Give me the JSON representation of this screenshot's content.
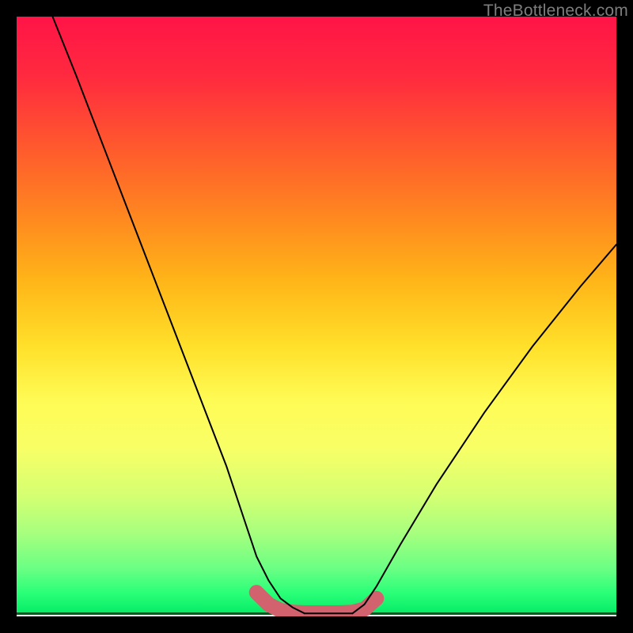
{
  "watermark": {
    "text": "TheBottleneck.com"
  },
  "colors": {
    "curve": "#000000",
    "highlight": "#d2636e",
    "background_black": "#000000"
  },
  "chart_data": {
    "type": "line",
    "title": "",
    "xlabel": "",
    "ylabel": "",
    "xlim": [
      0,
      100
    ],
    "ylim": [
      0,
      100
    ],
    "grid": false,
    "series": [
      {
        "name": "left-curve",
        "x": [
          6,
          10,
          15,
          20,
          25,
          30,
          35,
          38,
          40,
          42,
          44,
          46,
          48
        ],
        "y": [
          100,
          90,
          77,
          64,
          51,
          38,
          25,
          16,
          10,
          6,
          3,
          1.5,
          0.5
        ]
      },
      {
        "name": "bottom-flat",
        "x": [
          48,
          50,
          52,
          54,
          56
        ],
        "y": [
          0.5,
          0.5,
          0.5,
          0.5,
          0.5
        ]
      },
      {
        "name": "right-curve",
        "x": [
          56,
          58,
          60,
          64,
          70,
          78,
          86,
          94,
          100
        ],
        "y": [
          0.5,
          2,
          5,
          12,
          22,
          34,
          45,
          55,
          62
        ]
      }
    ],
    "annotations": [
      {
        "name": "trough-highlight",
        "x": [
          40,
          42,
          44,
          46,
          48,
          50,
          52,
          54,
          56,
          58,
          60
        ],
        "y": [
          4,
          2,
          1,
          0.7,
          0.6,
          0.6,
          0.6,
          0.6,
          0.7,
          1.2,
          3
        ]
      }
    ]
  }
}
